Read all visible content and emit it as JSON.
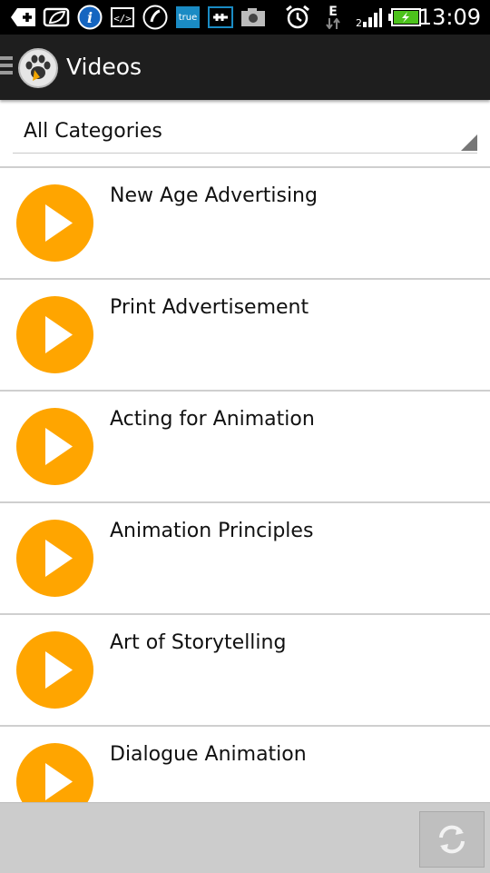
{
  "status_bar": {
    "time": "13:09",
    "network_type": "E",
    "true_badge": "true",
    "icons": [
      "plus-icon",
      "leaf-icon",
      "info-icon",
      "code-icon",
      "phone-icon",
      "true-app-icon",
      "usb-icon",
      "camera-icon",
      "alarm-icon",
      "network-e-icon",
      "signal-icon",
      "battery-charging-icon"
    ]
  },
  "action_bar": {
    "title": "Videos",
    "icons": [
      "drawer-icon",
      "paw-logo-icon"
    ]
  },
  "filter": {
    "selected_category": "All Categories"
  },
  "videos": [
    {
      "title": "New Age Advertising"
    },
    {
      "title": "Print Advertisement"
    },
    {
      "title": "Acting for Animation"
    },
    {
      "title": "Animation Principles"
    },
    {
      "title": "Art of Storytelling"
    },
    {
      "title": "Dialogue Animation"
    }
  ],
  "bottom_bar": {
    "icons": [
      "refresh-icon"
    ]
  },
  "colors": {
    "accent": "#FFA500",
    "action_bar": "#1E1E1E",
    "status_bar": "#000000",
    "battery": "#4CC21C",
    "true_badge": "#1A8BC4"
  }
}
